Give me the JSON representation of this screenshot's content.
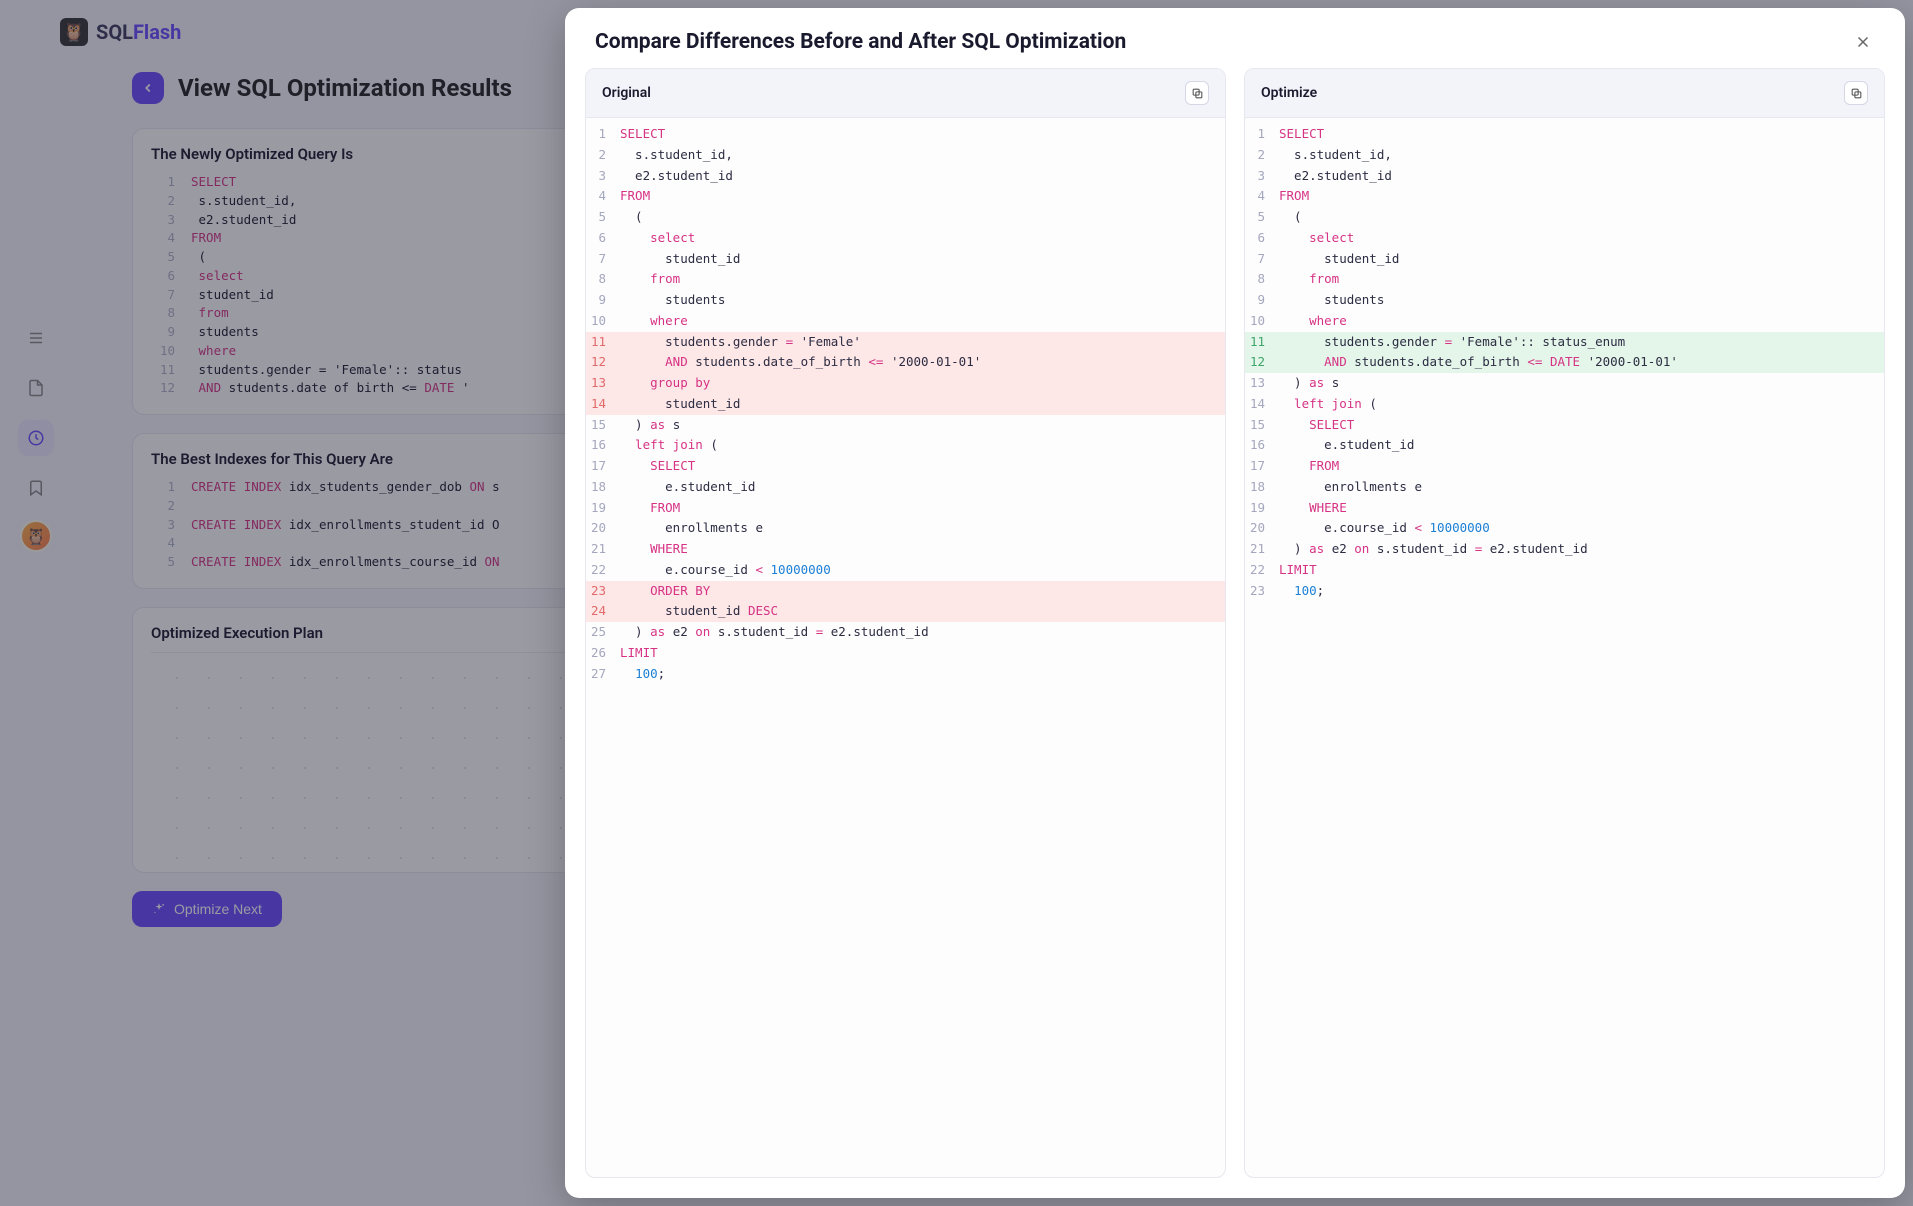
{
  "brand": {
    "sql": "SQL",
    "flash": "Flash"
  },
  "page": {
    "title": "View SQL Optimization Results"
  },
  "cards": {
    "new_query_title": "The Newly Optimized Query Is",
    "best_indexes_title": "The Best Indexes for This Query Are",
    "exec_plan_title": "Optimized Execution Plan"
  },
  "bg_new_query": [
    "SELECT",
    "  s.student_id,",
    "  e2.student_id",
    "FROM",
    "  (",
    "    select",
    "      student_id",
    "    from",
    "      students",
    "    where",
    "      students.gender = 'Female':: status",
    "      AND students.date of birth <= DATE '"
  ],
  "bg_indexes": [
    "CREATE INDEX idx_students_gender_dob ON s",
    "",
    "CREATE INDEX idx_enrollments_student_id O",
    "",
    "CREATE INDEX idx_enrollments_course_id ON"
  ],
  "optimize_next": "Optimize Next",
  "modal": {
    "title": "Compare Differences Before and After SQL Optimization",
    "original_label": "Original",
    "optimize_label": "Optimize"
  },
  "original_code": [
    {
      "n": 1,
      "diff": "",
      "t": [
        [
          "kw",
          "SELECT"
        ]
      ]
    },
    {
      "n": 2,
      "diff": "",
      "t": [
        [
          "id",
          "  s.student_id,"
        ]
      ]
    },
    {
      "n": 3,
      "diff": "",
      "t": [
        [
          "id",
          "  e2.student_id"
        ]
      ]
    },
    {
      "n": 4,
      "diff": "",
      "t": [
        [
          "kw",
          "FROM"
        ]
      ]
    },
    {
      "n": 5,
      "diff": "",
      "t": [
        [
          "id",
          "  ("
        ]
      ]
    },
    {
      "n": 6,
      "diff": "",
      "t": [
        [
          "kw",
          "    select"
        ]
      ]
    },
    {
      "n": 7,
      "diff": "",
      "t": [
        [
          "id",
          "      student_id"
        ]
      ]
    },
    {
      "n": 8,
      "diff": "",
      "t": [
        [
          "kw",
          "    from"
        ]
      ]
    },
    {
      "n": 9,
      "diff": "",
      "t": [
        [
          "id",
          "      students"
        ]
      ]
    },
    {
      "n": 10,
      "diff": "",
      "t": [
        [
          "kw",
          "    where"
        ]
      ]
    },
    {
      "n": 11,
      "diff": "del",
      "t": [
        [
          "id",
          "      students.gender "
        ],
        [
          "kw",
          "="
        ],
        [
          "id",
          " 'Female'"
        ]
      ]
    },
    {
      "n": 12,
      "diff": "del",
      "t": [
        [
          "id",
          "      "
        ],
        [
          "kw",
          "AND"
        ],
        [
          "id",
          " students.date_of_birth "
        ],
        [
          "kw",
          "<="
        ],
        [
          "id",
          " '2000-01-01'"
        ]
      ]
    },
    {
      "n": 13,
      "diff": "del",
      "t": [
        [
          "kw",
          "    group by"
        ]
      ]
    },
    {
      "n": 14,
      "diff": "del",
      "t": [
        [
          "id",
          "      student_id"
        ]
      ]
    },
    {
      "n": 15,
      "diff": "",
      "t": [
        [
          "id",
          "  ) "
        ],
        [
          "kw",
          "as"
        ],
        [
          "id",
          " s"
        ]
      ]
    },
    {
      "n": 16,
      "diff": "",
      "t": [
        [
          "kw",
          "  left join"
        ],
        [
          "id",
          " ("
        ]
      ]
    },
    {
      "n": 17,
      "diff": "",
      "t": [
        [
          "kw",
          "    SELECT"
        ]
      ]
    },
    {
      "n": 18,
      "diff": "",
      "t": [
        [
          "id",
          "      e.student_id"
        ]
      ]
    },
    {
      "n": 19,
      "diff": "",
      "t": [
        [
          "kw",
          "    FROM"
        ]
      ]
    },
    {
      "n": 20,
      "diff": "",
      "t": [
        [
          "id",
          "      enrollments e"
        ]
      ]
    },
    {
      "n": 21,
      "diff": "",
      "t": [
        [
          "kw",
          "    WHERE"
        ]
      ]
    },
    {
      "n": 22,
      "diff": "",
      "t": [
        [
          "id",
          "      e.course_id "
        ],
        [
          "kw",
          "<"
        ],
        [
          "id",
          " "
        ],
        [
          "num",
          "10000000"
        ]
      ]
    },
    {
      "n": 23,
      "diff": "del",
      "t": [
        [
          "kw",
          "    ORDER BY"
        ]
      ]
    },
    {
      "n": 24,
      "diff": "del",
      "t": [
        [
          "id",
          "      student_id "
        ],
        [
          "kw",
          "DESC"
        ]
      ]
    },
    {
      "n": 25,
      "diff": "",
      "t": [
        [
          "id",
          "  ) "
        ],
        [
          "kw",
          "as"
        ],
        [
          "id",
          " e2 "
        ],
        [
          "kw",
          "on"
        ],
        [
          "id",
          " s.student_id "
        ],
        [
          "kw",
          "="
        ],
        [
          "id",
          " e2.student_id"
        ]
      ]
    },
    {
      "n": 26,
      "diff": "",
      "t": [
        [
          "kw",
          "LIMIT"
        ]
      ]
    },
    {
      "n": 27,
      "diff": "",
      "t": [
        [
          "id",
          "  "
        ],
        [
          "num",
          "100"
        ],
        [
          "id",
          ";"
        ]
      ]
    }
  ],
  "optimize_code": [
    {
      "n": 1,
      "diff": "",
      "t": [
        [
          "kw",
          "SELECT"
        ]
      ]
    },
    {
      "n": 2,
      "diff": "",
      "t": [
        [
          "id",
          "  s.student_id,"
        ]
      ]
    },
    {
      "n": 3,
      "diff": "",
      "t": [
        [
          "id",
          "  e2.student_id"
        ]
      ]
    },
    {
      "n": 4,
      "diff": "",
      "t": [
        [
          "kw",
          "FROM"
        ]
      ]
    },
    {
      "n": 5,
      "diff": "",
      "t": [
        [
          "id",
          "  ("
        ]
      ]
    },
    {
      "n": 6,
      "diff": "",
      "t": [
        [
          "kw",
          "    select"
        ]
      ]
    },
    {
      "n": 7,
      "diff": "",
      "t": [
        [
          "id",
          "      student_id"
        ]
      ]
    },
    {
      "n": 8,
      "diff": "",
      "t": [
        [
          "kw",
          "    from"
        ]
      ]
    },
    {
      "n": 9,
      "diff": "",
      "t": [
        [
          "id",
          "      students"
        ]
      ]
    },
    {
      "n": 10,
      "diff": "",
      "t": [
        [
          "kw",
          "    where"
        ]
      ]
    },
    {
      "n": 11,
      "diff": "add",
      "t": [
        [
          "id",
          "      students.gender "
        ],
        [
          "kw",
          "="
        ],
        [
          "id",
          " 'Female':: status_enum"
        ]
      ]
    },
    {
      "n": 12,
      "diff": "add",
      "t": [
        [
          "id",
          "      "
        ],
        [
          "kw",
          "AND"
        ],
        [
          "id",
          " students.date_of_birth "
        ],
        [
          "kw",
          "<="
        ],
        [
          "id",
          " "
        ],
        [
          "kw",
          "DATE"
        ],
        [
          "id",
          " '2000-01-01'"
        ]
      ]
    },
    {
      "n": 13,
      "diff": "",
      "t": [
        [
          "id",
          "  ) "
        ],
        [
          "kw",
          "as"
        ],
        [
          "id",
          " s"
        ]
      ]
    },
    {
      "n": 14,
      "diff": "",
      "t": [
        [
          "kw",
          "  left join"
        ],
        [
          "id",
          " ("
        ]
      ]
    },
    {
      "n": 15,
      "diff": "",
      "t": [
        [
          "kw",
          "    SELECT"
        ]
      ]
    },
    {
      "n": 16,
      "diff": "",
      "t": [
        [
          "id",
          "      e.student_id"
        ]
      ]
    },
    {
      "n": 17,
      "diff": "",
      "t": [
        [
          "kw",
          "    FROM"
        ]
      ]
    },
    {
      "n": 18,
      "diff": "",
      "t": [
        [
          "id",
          "      enrollments e"
        ]
      ]
    },
    {
      "n": 19,
      "diff": "",
      "t": [
        [
          "kw",
          "    WHERE"
        ]
      ]
    },
    {
      "n": 20,
      "diff": "",
      "t": [
        [
          "id",
          "      e.course_id "
        ],
        [
          "kw",
          "<"
        ],
        [
          "id",
          " "
        ],
        [
          "num",
          "10000000"
        ]
      ]
    },
    {
      "n": 21,
      "diff": "",
      "t": [
        [
          "id",
          "  ) "
        ],
        [
          "kw",
          "as"
        ],
        [
          "id",
          " e2 "
        ],
        [
          "kw",
          "on"
        ],
        [
          "id",
          " s.student_id "
        ],
        [
          "kw",
          "="
        ],
        [
          "id",
          " e2.student_id"
        ]
      ]
    },
    {
      "n": 22,
      "diff": "",
      "t": [
        [
          "kw",
          "LIMIT"
        ]
      ]
    },
    {
      "n": 23,
      "diff": "",
      "t": [
        [
          "id",
          "  "
        ],
        [
          "num",
          "100"
        ],
        [
          "id",
          ";"
        ]
      ]
    }
  ]
}
